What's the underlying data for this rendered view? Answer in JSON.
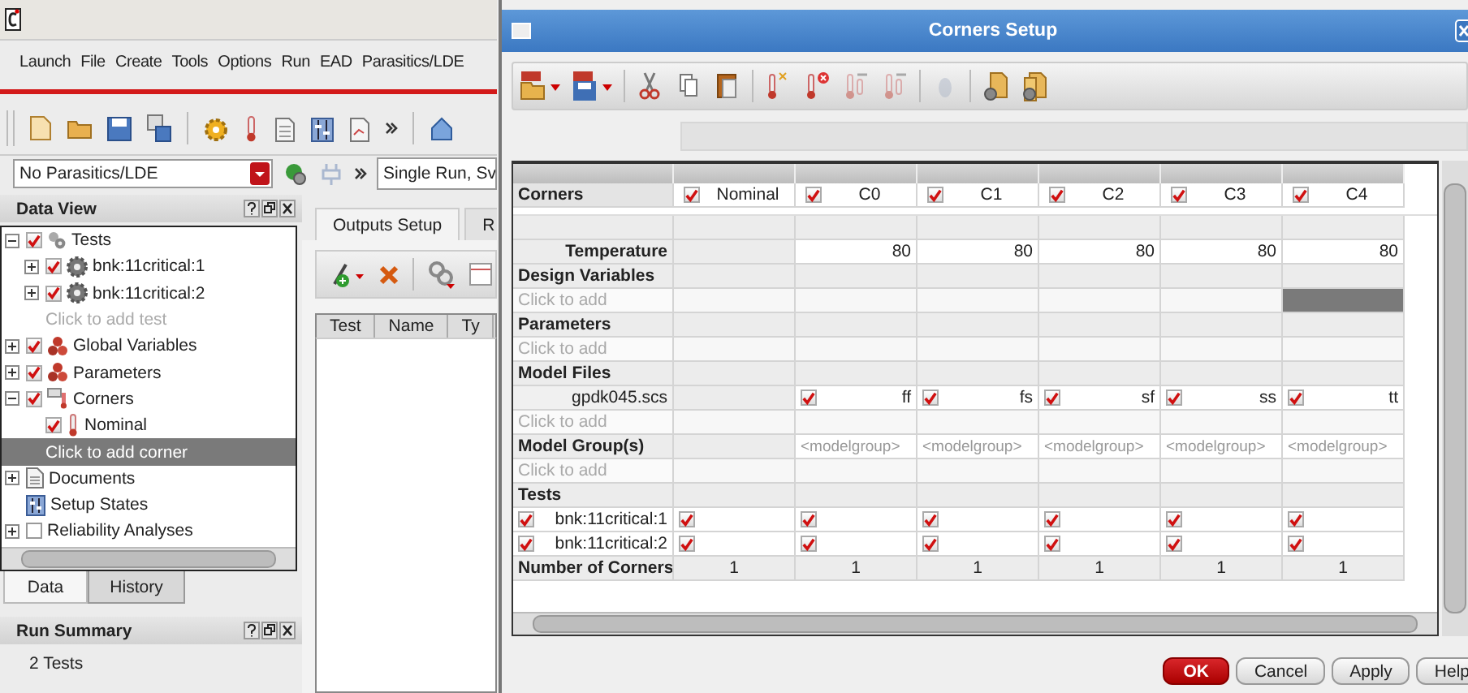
{
  "main_window": {
    "menu": [
      "Launch",
      "File",
      "Create",
      "Tools",
      "Options",
      "Run",
      "EAD",
      "Parasitics/LDE"
    ],
    "parasitics": {
      "value": "No Parasitics/LDE"
    },
    "run_mode": {
      "value": "Single Run, Sv"
    },
    "data_view": {
      "title": "Data View",
      "tree": [
        {
          "kind": "tests",
          "label": "Tests",
          "checked": true,
          "expanded": true,
          "selected": false,
          "children": [
            {
              "kind": "test",
              "label": "bnk:11critical:1",
              "checked": true,
              "expanded": false,
              "selected": false
            },
            {
              "kind": "test",
              "label": "bnk:11critical:2",
              "checked": true,
              "expanded": false,
              "selected": false
            },
            {
              "kind": "add",
              "label": "Click to add test",
              "selected": false
            }
          ]
        },
        {
          "kind": "variables",
          "label": "Global Variables",
          "checked": true,
          "expanded": false,
          "selected": false
        },
        {
          "kind": "variables",
          "label": "Parameters",
          "checked": true,
          "expanded": false,
          "selected": false
        },
        {
          "kind": "corners",
          "label": "Corners",
          "checked": true,
          "expanded": true,
          "selected": false,
          "children": [
            {
              "kind": "corner",
              "label": "Nominal",
              "checked": true,
              "selected": false
            },
            {
              "kind": "add",
              "label": "Click to add corner",
              "selected": true
            }
          ]
        },
        {
          "kind": "documents",
          "label": "Documents",
          "expanded": false,
          "selected": false
        },
        {
          "kind": "states",
          "label": "Setup States",
          "selected": false
        },
        {
          "kind": "reliability",
          "label": "Reliability Analyses",
          "checked": false,
          "expanded": false,
          "selected": false
        }
      ]
    },
    "bottom_tabs": [
      {
        "label": "Data",
        "selected": true
      },
      {
        "label": "History",
        "selected": false
      }
    ],
    "run_summary": {
      "title": "Run Summary",
      "text": "2 Tests"
    },
    "outputs": {
      "tabs": [
        {
          "label": "Outputs Setup",
          "selected": true
        },
        {
          "label": "R",
          "selected": false
        }
      ],
      "columns": [
        "Test",
        "Name",
        "Ty"
      ]
    }
  },
  "dialog": {
    "title": "Corners Setup",
    "toolbar": [
      {
        "kind": "csv-open",
        "disabled": false
      },
      {
        "kind": "csv-save",
        "disabled": false
      },
      {
        "kind": "sep"
      },
      {
        "kind": "cut",
        "disabled": false
      },
      {
        "kind": "copy",
        "disabled": false
      },
      {
        "kind": "paste",
        "disabled": false
      },
      {
        "kind": "sep"
      },
      {
        "kind": "thermo-new",
        "disabled": false
      },
      {
        "kind": "thermo-delete",
        "disabled": false
      },
      {
        "kind": "thermo-right",
        "disabled": true
      },
      {
        "kind": "thermo-left",
        "disabled": true
      },
      {
        "kind": "sep"
      },
      {
        "kind": "bulb",
        "disabled": true
      },
      {
        "kind": "sep"
      },
      {
        "kind": "gear-doc",
        "disabled": false
      },
      {
        "kind": "gear-docs",
        "disabled": false
      }
    ],
    "corners_label": "Corners",
    "corners": [
      {
        "name": "Nominal",
        "checked": true
      },
      {
        "name": "C0",
        "checked": true
      },
      {
        "name": "C1",
        "checked": true
      },
      {
        "name": "C2",
        "checked": true
      },
      {
        "name": "C3",
        "checked": true
      },
      {
        "name": "C4",
        "checked": true
      }
    ],
    "rows": [
      {
        "kind": "blank"
      },
      {
        "kind": "values",
        "label": "Temperature",
        "cells": [
          null,
          "80",
          "80",
          "80",
          "80",
          "80"
        ]
      },
      {
        "kind": "section",
        "label": "Design Variables"
      },
      {
        "kind": "add",
        "label": "Click to add",
        "cells": [
          {
            "selected": false
          },
          {
            "selected": false
          },
          {
            "selected": false
          },
          {
            "selected": false
          },
          {
            "selected": false
          },
          {
            "selected": true
          }
        ]
      },
      {
        "kind": "section",
        "label": "Parameters"
      },
      {
        "kind": "add",
        "label": "Click to add",
        "cells": [
          {
            "selected": false
          },
          {
            "selected": false
          },
          {
            "selected": false
          },
          {
            "selected": false
          },
          {
            "selected": false
          },
          {
            "selected": false
          }
        ]
      },
      {
        "kind": "section",
        "label": "Model Files"
      },
      {
        "kind": "model",
        "label": "gpdk045.scs",
        "cells": [
          null,
          {
            "checked": true,
            "section": "ff"
          },
          {
            "checked": true,
            "section": "fs"
          },
          {
            "checked": true,
            "section": "sf"
          },
          {
            "checked": true,
            "section": "ss"
          },
          {
            "checked": true,
            "section": "tt"
          }
        ]
      },
      {
        "kind": "add",
        "label": "Click to add",
        "cells": [
          {
            "selected": false
          },
          {
            "selected": false
          },
          {
            "selected": false
          },
          {
            "selected": false
          },
          {
            "selected": false
          },
          {
            "selected": false
          }
        ]
      },
      {
        "kind": "section",
        "label": "Model Group(s)",
        "cells": [
          null,
          "<modelgroup>",
          "<modelgroup>",
          "<modelgroup>",
          "<modelgroup>",
          "<modelgroup>"
        ]
      },
      {
        "kind": "add",
        "label": "Click to add",
        "cells": [
          {
            "selected": false
          },
          {
            "selected": false
          },
          {
            "selected": false
          },
          {
            "selected": false
          },
          {
            "selected": false
          },
          {
            "selected": false
          }
        ]
      },
      {
        "kind": "section",
        "label": "Tests"
      },
      {
        "kind": "test",
        "label": "bnk:11critical:1",
        "checked": true,
        "cells": [
          true,
          true,
          true,
          true,
          true,
          true
        ]
      },
      {
        "kind": "test",
        "label": "bnk:11critical:2",
        "checked": true,
        "cells": [
          true,
          true,
          true,
          true,
          true,
          true
        ]
      },
      {
        "kind": "count",
        "label": "Number of Corners",
        "cells": [
          "1",
          "1",
          "1",
          "1",
          "1",
          "1"
        ]
      }
    ],
    "buttons": [
      {
        "label": "OK",
        "kind": "primary"
      },
      {
        "label": "Cancel",
        "kind": "normal"
      },
      {
        "label": "Apply",
        "kind": "normal"
      },
      {
        "label": "Help",
        "kind": "normal"
      }
    ]
  }
}
